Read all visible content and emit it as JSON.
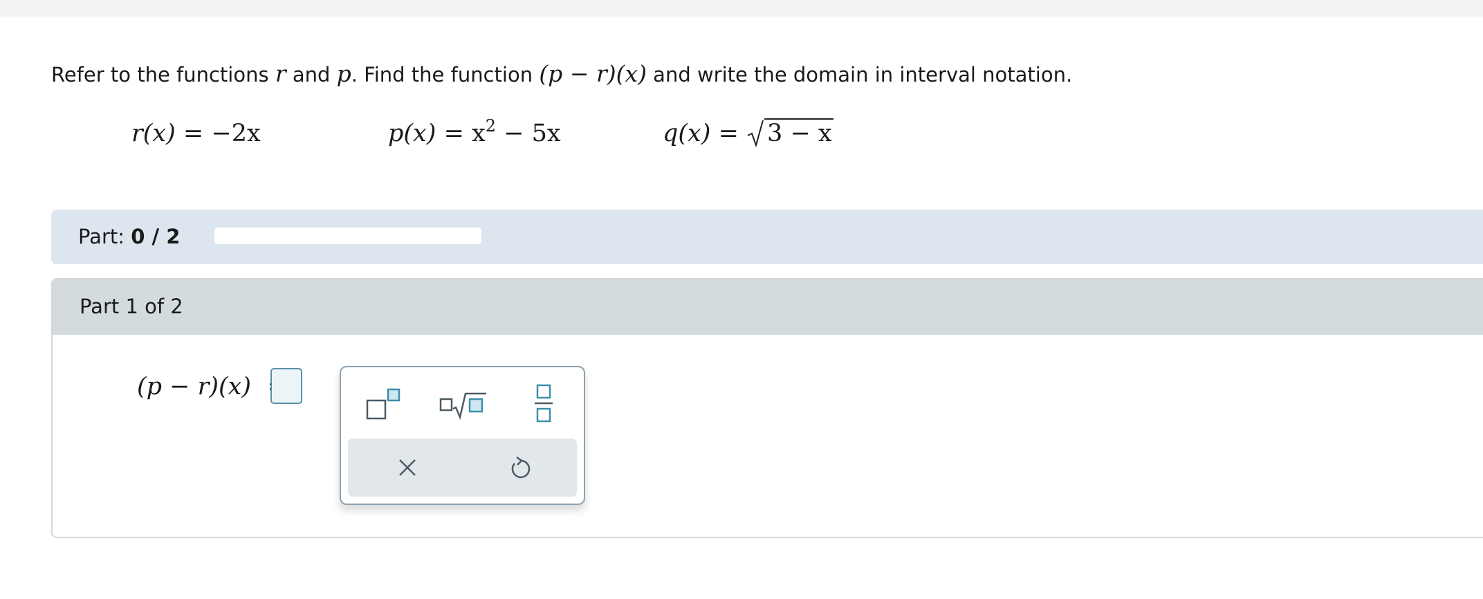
{
  "question": {
    "text_1": "Refer to the functions",
    "var_r": "r",
    "text_2": "and",
    "var_p": "p",
    "text_3": ". Find the function",
    "target_function": "(p − r)(x)",
    "text_4": "and write the domain in interval notation."
  },
  "functions": {
    "r": {
      "lhs": "r",
      "arg": "(x)",
      "rhs": " = −2x"
    },
    "p": {
      "lhs": "p",
      "arg": "(x)",
      "rhs_a": " = x",
      "exponent": "2",
      "rhs_b": " − 5x"
    },
    "q": {
      "lhs": "q",
      "arg": "(x)",
      "rhs": " = ",
      "radicand": "3 − x"
    }
  },
  "progress": {
    "label": "Part:",
    "value": "0 / 2",
    "fraction": 0
  },
  "part": {
    "header": "Part 1 of 2",
    "equation_label": "(p − r)(x)",
    "equals": "=",
    "answer_value": ""
  },
  "palette": {
    "tools": [
      "superscript-icon",
      "nth-root-icon",
      "fraction-icon"
    ],
    "actions": [
      "clear-icon",
      "undo-icon"
    ]
  },
  "colors": {
    "progress_track": "#dde6ef",
    "part_header": "#d4dbdf",
    "answer_box_border": "#5b8fa8",
    "icon_accent": "#3d8fae"
  }
}
